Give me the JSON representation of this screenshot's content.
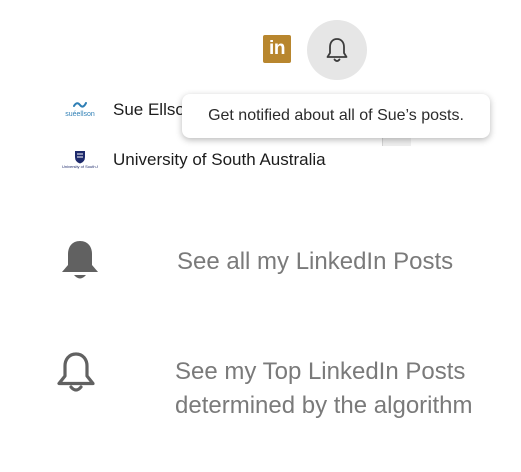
{
  "header": {
    "linkedin_badge_text": "in",
    "bell_button_icon": "bell-outline-icon"
  },
  "profiles": [
    {
      "name": "Sue Ellso",
      "logo_text": "suéellson",
      "logo_icon": "sue-ellson-logo"
    },
    {
      "name": "University of South Australia",
      "logo_text": "University of South Australia",
      "logo_icon": "unisa-crest-logo"
    }
  ],
  "tooltip": {
    "text": "Get notified about all of Sue’s posts."
  },
  "legend": [
    {
      "icon": "bell-filled-icon",
      "text_lines": [
        "See all my LinkedIn Posts"
      ]
    },
    {
      "icon": "bell-outline-icon",
      "text_lines": [
        "See my Top LinkedIn Posts",
        "determined by the algorithm"
      ]
    }
  ],
  "colors": {
    "linkedin_badge": "#b8862e",
    "bell_circle_bg": "#e6e6e6",
    "icon_gray": "#616161",
    "legend_text": "#7a7a7a",
    "sue_logo_blue": "#2f7fb5",
    "unisa_navy": "#1d2a6b"
  }
}
